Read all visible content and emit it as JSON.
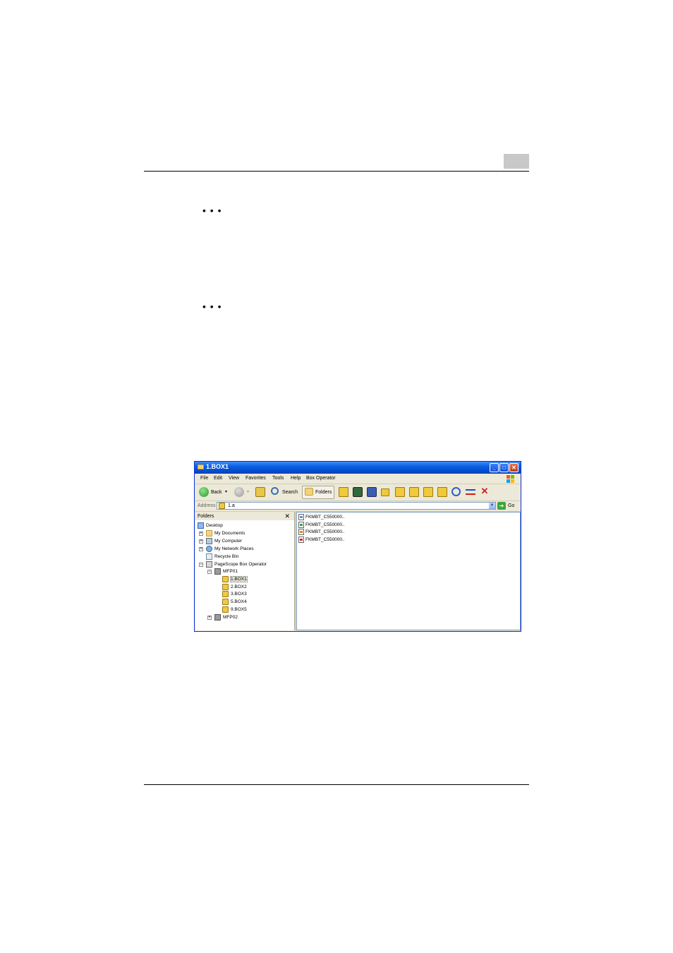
{
  "page": {
    "bullet_dots_1": "• • •",
    "bullet_dots_2": "• • •"
  },
  "window": {
    "title": "1.BOX1",
    "title_buttons": {
      "minimize": "_",
      "maximize": "□",
      "close": "✕"
    },
    "menu": [
      "File",
      "Edit",
      "View",
      "Favorites",
      "Tools",
      "Help",
      "Box Operator"
    ],
    "toolbar": {
      "back_label": "Back",
      "search_label": "Search",
      "folders_label": "Folders"
    },
    "address": {
      "label": "Address",
      "value": "1.a",
      "go_label": "Go"
    },
    "folders_pane": {
      "title": "Folders",
      "close": "✕",
      "tree": [
        {
          "label": "Desktop",
          "icon": "desktop-icon",
          "expander": ""
        },
        {
          "label": "My Documents",
          "icon": "folder-icon",
          "expander": "+"
        },
        {
          "label": "My Computer",
          "icon": "computer-icon",
          "expander": "+"
        },
        {
          "label": "My Network Places",
          "icon": "network-icon",
          "expander": "+"
        },
        {
          "label": "Recycle Bin",
          "icon": "recycle-bin-icon",
          "expander": ""
        },
        {
          "label": "PageScope Box Operator",
          "icon": "app-icon",
          "expander": "−"
        },
        {
          "label": "MFP01",
          "icon": "mfp-icon",
          "expander": "−"
        },
        {
          "label": "1.BOX1",
          "icon": "box-icon",
          "expander": "",
          "selected": true
        },
        {
          "label": "2.BOX2",
          "icon": "box-icon",
          "expander": ""
        },
        {
          "label": "3.BOX3",
          "icon": "box-icon",
          "expander": ""
        },
        {
          "label": "5.BOX4",
          "icon": "box-icon",
          "expander": ""
        },
        {
          "label": "9.BOX5",
          "icon": "box-icon",
          "expander": ""
        },
        {
          "label": "MFP02",
          "icon": "mfp-icon",
          "expander": "+"
        }
      ]
    },
    "files": [
      {
        "name": "FKMBT_C550000..",
        "color": "#6a8fc9"
      },
      {
        "name": "FKMBT_C550000..",
        "color": "#3f9e5a"
      },
      {
        "name": "FKMBT_C550000..",
        "color": "#d88a2e"
      },
      {
        "name": "FKMBT_C550000..",
        "color": "#c2332f"
      }
    ]
  }
}
